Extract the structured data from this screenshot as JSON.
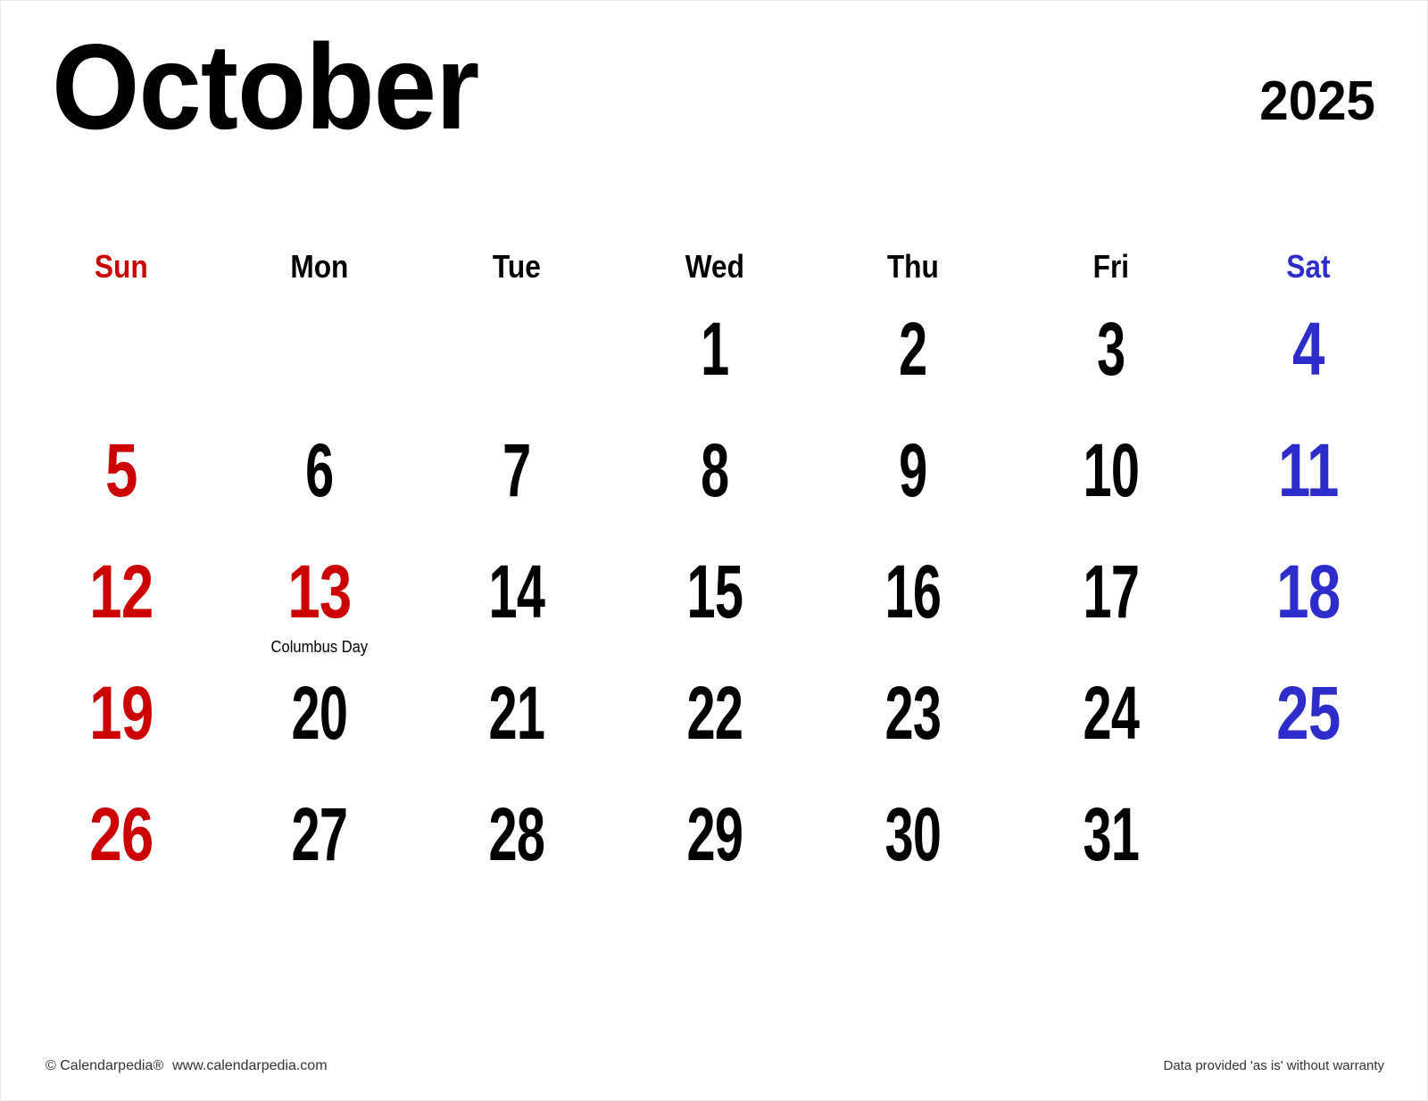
{
  "header": {
    "month": "October",
    "year": "2025"
  },
  "colors": {
    "sunday": "#cc0000",
    "saturday": "#2d2dcc",
    "weekday": "#000000",
    "holiday": "#cc0000",
    "background": "#ffffff"
  },
  "weekdays": [
    {
      "label": "Sun",
      "kind": "sun"
    },
    {
      "label": "Mon",
      "kind": "weekday"
    },
    {
      "label": "Tue",
      "kind": "weekday"
    },
    {
      "label": "Wed",
      "kind": "weekday"
    },
    {
      "label": "Thu",
      "kind": "weekday"
    },
    {
      "label": "Fri",
      "kind": "weekday"
    },
    {
      "label": "Sat",
      "kind": "sat"
    }
  ],
  "weeks": [
    [
      {
        "day": "",
        "kind": "empty",
        "holiday": ""
      },
      {
        "day": "",
        "kind": "empty",
        "holiday": ""
      },
      {
        "day": "",
        "kind": "empty",
        "holiday": ""
      },
      {
        "day": "1",
        "kind": "weekday",
        "holiday": ""
      },
      {
        "day": "2",
        "kind": "weekday",
        "holiday": ""
      },
      {
        "day": "3",
        "kind": "weekday",
        "holiday": ""
      },
      {
        "day": "4",
        "kind": "sat",
        "holiday": ""
      }
    ],
    [
      {
        "day": "5",
        "kind": "sun",
        "holiday": ""
      },
      {
        "day": "6",
        "kind": "weekday",
        "holiday": ""
      },
      {
        "day": "7",
        "kind": "weekday",
        "holiday": ""
      },
      {
        "day": "8",
        "kind": "weekday",
        "holiday": ""
      },
      {
        "day": "9",
        "kind": "weekday",
        "holiday": ""
      },
      {
        "day": "10",
        "kind": "weekday",
        "holiday": ""
      },
      {
        "day": "11",
        "kind": "sat",
        "holiday": ""
      }
    ],
    [
      {
        "day": "12",
        "kind": "sun",
        "holiday": ""
      },
      {
        "day": "13",
        "kind": "holiday",
        "holiday": "Columbus Day"
      },
      {
        "day": "14",
        "kind": "weekday",
        "holiday": ""
      },
      {
        "day": "15",
        "kind": "weekday",
        "holiday": ""
      },
      {
        "day": "16",
        "kind": "weekday",
        "holiday": ""
      },
      {
        "day": "17",
        "kind": "weekday",
        "holiday": ""
      },
      {
        "day": "18",
        "kind": "sat",
        "holiday": ""
      }
    ],
    [
      {
        "day": "19",
        "kind": "sun",
        "holiday": ""
      },
      {
        "day": "20",
        "kind": "weekday",
        "holiday": ""
      },
      {
        "day": "21",
        "kind": "weekday",
        "holiday": ""
      },
      {
        "day": "22",
        "kind": "weekday",
        "holiday": ""
      },
      {
        "day": "23",
        "kind": "weekday",
        "holiday": ""
      },
      {
        "day": "24",
        "kind": "weekday",
        "holiday": ""
      },
      {
        "day": "25",
        "kind": "sat",
        "holiday": ""
      }
    ],
    [
      {
        "day": "26",
        "kind": "sun",
        "holiday": ""
      },
      {
        "day": "27",
        "kind": "weekday",
        "holiday": ""
      },
      {
        "day": "28",
        "kind": "weekday",
        "holiday": ""
      },
      {
        "day": "29",
        "kind": "weekday",
        "holiday": ""
      },
      {
        "day": "30",
        "kind": "weekday",
        "holiday": ""
      },
      {
        "day": "31",
        "kind": "weekday",
        "holiday": ""
      },
      {
        "day": "",
        "kind": "empty",
        "holiday": ""
      }
    ]
  ],
  "footer": {
    "copyright": "© Calendarpedia®",
    "website": "www.calendarpedia.com",
    "disclaimer": "Data provided 'as is' without warranty"
  }
}
